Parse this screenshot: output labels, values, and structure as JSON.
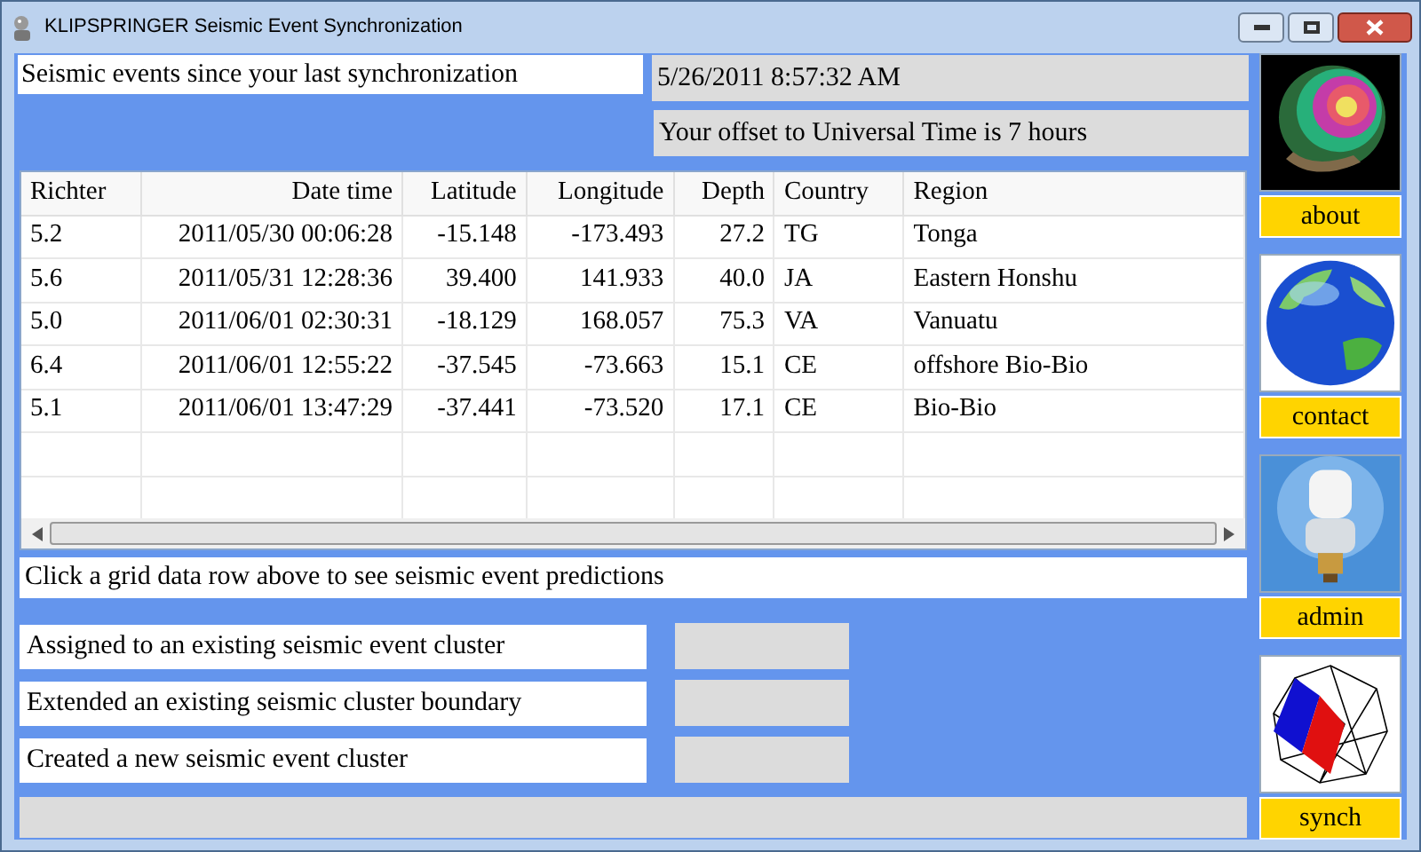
{
  "window": {
    "title": "KLIPSPRINGER Seismic Event Synchronization"
  },
  "heading": "Seismic events since your last synchronization",
  "timestamp": "5/26/2011 8:57:32 AM",
  "offset": "Your offset to Universal Time is 7 hours",
  "table": {
    "columns": [
      "Richter",
      "Date time",
      "Latitude",
      "Longitude",
      "Depth",
      "Country",
      "Region"
    ],
    "rows": [
      [
        "5.2",
        "2011/05/30 00:06:28",
        "-15.148",
        "-173.493",
        "27.2",
        "TG",
        "Tonga"
      ],
      [
        "5.6",
        "2011/05/31 12:28:36",
        "39.400",
        "141.933",
        "40.0",
        "JA",
        "Eastern Honshu"
      ],
      [
        "5.0",
        "2011/06/01 02:30:31",
        "-18.129",
        "168.057",
        "75.3",
        "VA",
        "Vanuatu"
      ],
      [
        "6.4",
        "2011/06/01 12:55:22",
        "-37.545",
        "-73.663",
        "15.1",
        "CE",
        "offshore Bio-Bio"
      ],
      [
        "5.1",
        "2011/06/01 13:47:29",
        "-37.441",
        "-73.520",
        "17.1",
        "CE",
        "Bio-Bio"
      ]
    ]
  },
  "hint": "Click a grid data row above to see seismic event predictions",
  "clusters": [
    {
      "label": "Assigned to an existing seismic event cluster"
    },
    {
      "label": "Extended an existing seismic cluster boundary"
    },
    {
      "label": "Created a new seismic event cluster"
    }
  ],
  "side_buttons": [
    {
      "label": "about",
      "kind": "spiral"
    },
    {
      "label": "contact",
      "kind": "globe"
    },
    {
      "label": "admin",
      "kind": "bulb"
    },
    {
      "label": "synch",
      "kind": "wireframe"
    }
  ]
}
